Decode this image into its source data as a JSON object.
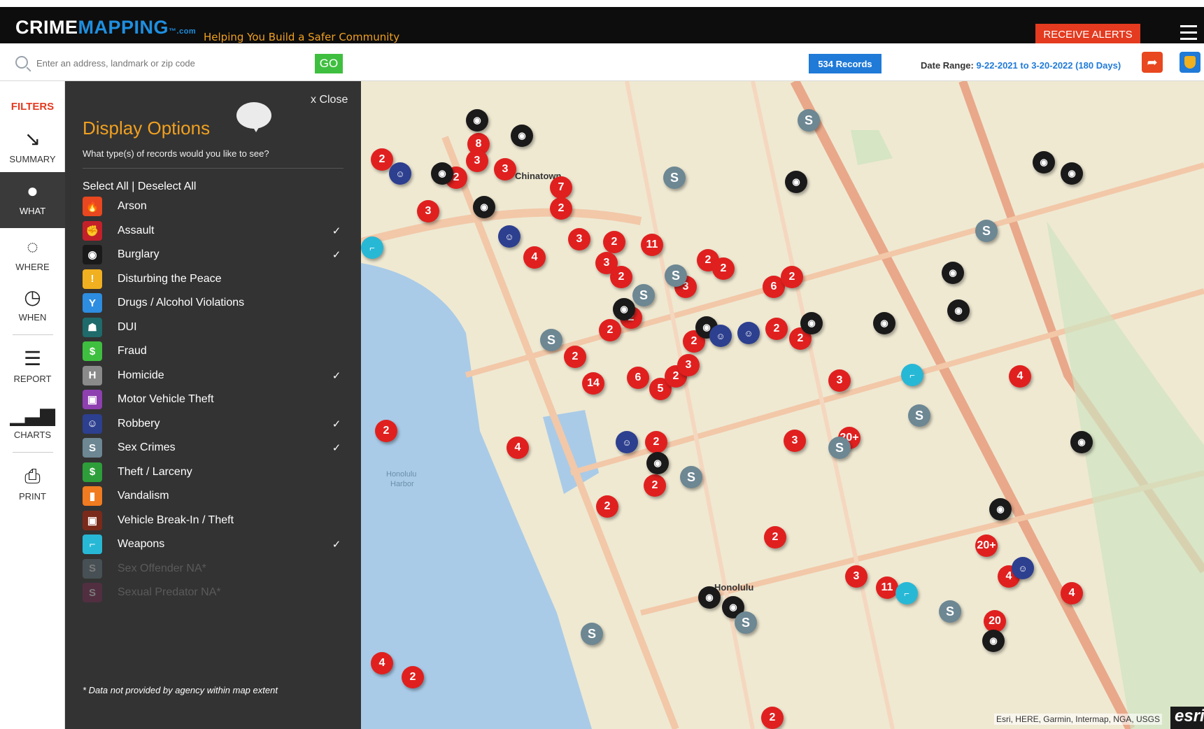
{
  "header": {
    "logo_crime": "CRIME",
    "logo_mapping": "MAPPING",
    "logo_com": "™.com",
    "tagline": "Helping You Build a Safer Community",
    "alerts_label": "RECEIVE ALERTS"
  },
  "search": {
    "placeholder": "Enter an address, landmark or zip code",
    "go_label": "GO",
    "records_label": "534 Records",
    "date_range_label": "Date Range:",
    "date_range_value": "9-22-2021 to 3-20-2022 (180 Days)"
  },
  "rail": {
    "filters": "FILTERS",
    "summary": "SUMMARY",
    "what": "WHAT",
    "where": "WHERE",
    "when": "WHEN",
    "report": "REPORT",
    "charts": "CHARTS",
    "print": "PRINT"
  },
  "panel": {
    "close_label": "x Close",
    "title": "Display Options",
    "subtitle": "What type(s) of records would you like to see?",
    "select_all": "Select All",
    "separator": "|",
    "deselect_all": "Deselect All",
    "crime_types": [
      {
        "label": "Arson",
        "checked": false,
        "color": "#e8471f",
        "glyph": "🔥"
      },
      {
        "label": "Assault",
        "checked": true,
        "color": "#c4202a",
        "glyph": "✊"
      },
      {
        "label": "Burglary",
        "checked": true,
        "color": "#1a1a1a",
        "glyph": "◉"
      },
      {
        "label": "Disturbing the Peace",
        "checked": false,
        "color": "#f0b020",
        "glyph": "!"
      },
      {
        "label": "Drugs / Alcohol Violations",
        "checked": false,
        "color": "#2d8de0",
        "glyph": "Y"
      },
      {
        "label": "DUI",
        "checked": false,
        "color": "#1f6a6a",
        "glyph": "☗"
      },
      {
        "label": "Fraud",
        "checked": false,
        "color": "#3fbf3f",
        "glyph": "$"
      },
      {
        "label": "Homicide",
        "checked": true,
        "color": "#8a8a8a",
        "glyph": "H"
      },
      {
        "label": "Motor Vehicle Theft",
        "checked": false,
        "color": "#8e3fb0",
        "glyph": "▣"
      },
      {
        "label": "Robbery",
        "checked": true,
        "color": "#2d3f8f",
        "glyph": "☺"
      },
      {
        "label": "Sex Crimes",
        "checked": true,
        "color": "#6d8793",
        "glyph": "S"
      },
      {
        "label": "Theft / Larceny",
        "checked": false,
        "color": "#2e9e3a",
        "glyph": "$"
      },
      {
        "label": "Vandalism",
        "checked": false,
        "color": "#f07b20",
        "glyph": "▮"
      },
      {
        "label": "Vehicle Break-In / Theft",
        "checked": false,
        "color": "#7a2a1a",
        "glyph": "▣"
      },
      {
        "label": "Weapons",
        "checked": true,
        "color": "#27b8d6",
        "glyph": "⌐"
      },
      {
        "label": "Sex Offender NA*",
        "checked": false,
        "color": "#6d8793",
        "glyph": "S",
        "dim": true
      },
      {
        "label": "Sexual Predator NA*",
        "checked": false,
        "color": "#8a2a5a",
        "glyph": "S",
        "dim": true
      }
    ],
    "check_mark": "✓",
    "footnote": "* Data not provided by agency within map extent"
  },
  "map": {
    "labels": {
      "chinatown": "Chinatown",
      "honolulu": "Honolulu",
      "harbor_1": "Honolulu",
      "harbor_2": "Harbor"
    },
    "attribution": "Esri, HERE, Garmin, Intermap, NGA, USGS",
    "esri_logo": "esri",
    "marker_labels": [
      "2",
      "8",
      "3",
      "3",
      "2",
      "7",
      "3",
      "2",
      "11",
      "3",
      "2",
      "4",
      "2",
      "3",
      "2",
      "2",
      "3",
      "6",
      "2",
      "2",
      "2",
      "2",
      "3",
      "2",
      "2",
      "14",
      "6",
      "5",
      "2",
      "3",
      "2",
      "3",
      "20+",
      "4",
      "2",
      "2",
      "2",
      "4",
      "20+",
      "4",
      "3",
      "11",
      "2",
      "20",
      "2",
      "4",
      "2",
      "4",
      "2"
    ]
  }
}
